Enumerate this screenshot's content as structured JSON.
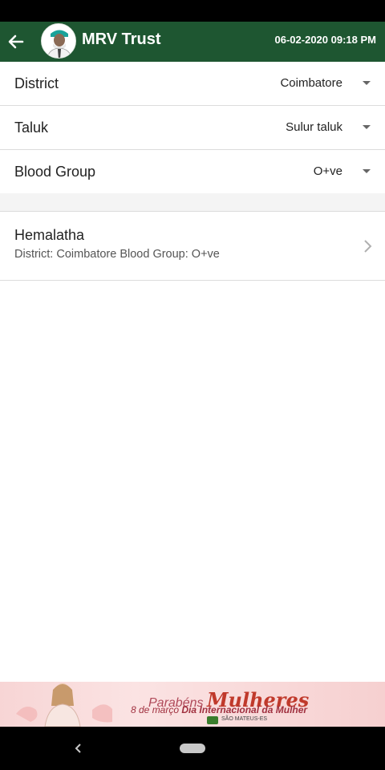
{
  "app_bar": {
    "title": "MRV Trust",
    "datetime": "06-02-2020 09:18 PM",
    "back_icon": "arrow-left-icon",
    "color": "#1e5631"
  },
  "filters": [
    {
      "label": "District",
      "value": "Coimbatore"
    },
    {
      "label": "Taluk",
      "value": "Sulur taluk"
    },
    {
      "label": "Blood Group",
      "value": "O+ve"
    }
  ],
  "results": [
    {
      "name": "Hemalatha",
      "details": "District: Coimbatore Blood Group: O+ve"
    }
  ],
  "ad": {
    "line1_prefix": "Parabéns",
    "line1_big": "Mulheres",
    "line2_prefix": "8 de março",
    "line2_bold": "Dia Internacional da Mulher",
    "line3": "SÃO MATEUS-ES"
  }
}
